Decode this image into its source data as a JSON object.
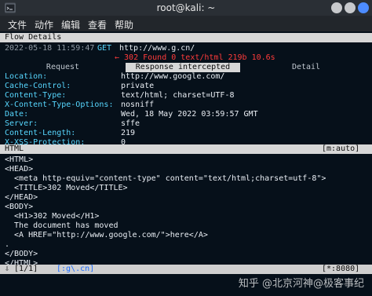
{
  "window": {
    "title": "root@kali: ~"
  },
  "menu": {
    "items": [
      "文件",
      "动作",
      "编辑",
      "查看",
      "帮助"
    ]
  },
  "flow": {
    "header": "Flow Details",
    "meta": "2022-05-18 11:59:47",
    "method": "GET",
    "url": "http://www.g.cn/",
    "response_line": "← 302 Found 0 text/html 219b 10.6s",
    "tabs": [
      "Request",
      "Response intercepted",
      "Detail"
    ],
    "headers": [
      {
        "k": "Location:",
        "v": "http://www.google.com/"
      },
      {
        "k": "Cache-Control:",
        "v": "private"
      },
      {
        "k": "Content-Type:",
        "v": "text/html; charset=UTF-8"
      },
      {
        "k": "X-Content-Type-Options:",
        "v": "nosniff"
      },
      {
        "k": "Date:",
        "v": "Wed, 18 May 2022 03:59:57 GMT"
      },
      {
        "k": "Server:",
        "v": "sffe"
      },
      {
        "k": "Content-Length:",
        "v": "219"
      },
      {
        "k": "X-XSS-Protection:",
        "v": "0"
      }
    ],
    "section_label": "HTML",
    "section_mode": "[m:auto]",
    "body_lines": [
      "<HTML>",
      "<HEAD>",
      "  <meta http-equiv=\"content-type\" content=\"text/html;charset=utf-8\">",
      "  <TITLE>302 Moved</TITLE>",
      "</HEAD>",
      "<BODY>",
      "  <H1>302 Moved</H1>",
      "  The document has moved",
      "  <A HREF=\"http://www.google.com/\">here</A>",
      ".",
      "</BODY>",
      "</HTML>"
    ],
    "status_left": "⇩ [1/1]",
    "status_filter": "[:g\\.cn]",
    "status_right": "[*:8080]"
  },
  "watermark": "知乎 @北京河神@极客事纪"
}
